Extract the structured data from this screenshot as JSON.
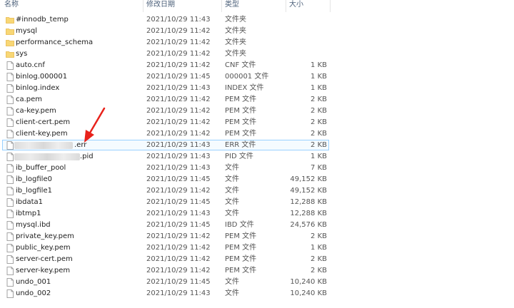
{
  "columns": {
    "name": "名称",
    "date": "修改日期",
    "type": "类型",
    "size": "大小"
  },
  "files": [
    {
      "name": "#innodb_temp",
      "date": "2021/10/29 11:43",
      "type": "文件夹",
      "size": "",
      "kind": "folder"
    },
    {
      "name": "mysql",
      "date": "2021/10/29 11:42",
      "type": "文件夹",
      "size": "",
      "kind": "folder"
    },
    {
      "name": "performance_schema",
      "date": "2021/10/29 11:42",
      "type": "文件夹",
      "size": "",
      "kind": "folder"
    },
    {
      "name": "sys",
      "date": "2021/10/29 11:42",
      "type": "文件夹",
      "size": "",
      "kind": "folder"
    },
    {
      "name": "auto.cnf",
      "date": "2021/10/29 11:42",
      "type": "CNF 文件",
      "size": "1 KB",
      "kind": "file"
    },
    {
      "name": "binlog.000001",
      "date": "2021/10/29 11:45",
      "type": "000001 文件",
      "size": "1 KB",
      "kind": "file"
    },
    {
      "name": "binlog.index",
      "date": "2021/10/29 11:43",
      "type": "INDEX 文件",
      "size": "1 KB",
      "kind": "file"
    },
    {
      "name": "ca.pem",
      "date": "2021/10/29 11:42",
      "type": "PEM 文件",
      "size": "2 KB",
      "kind": "file"
    },
    {
      "name": "ca-key.pem",
      "date": "2021/10/29 11:42",
      "type": "PEM 文件",
      "size": "2 KB",
      "kind": "file"
    },
    {
      "name": "client-cert.pem",
      "date": "2021/10/29 11:42",
      "type": "PEM 文件",
      "size": "2 KB",
      "kind": "file"
    },
    {
      "name": "client-key.pem",
      "date": "2021/10/29 11:42",
      "type": "PEM 文件",
      "size": "2 KB",
      "kind": "file"
    },
    {
      "name": ".err",
      "date": "2021/10/29 11:43",
      "type": "ERR 文件",
      "size": "2 KB",
      "kind": "file"
    },
    {
      "name": ".pid",
      "date": "2021/10/29 11:43",
      "type": "PID 文件",
      "size": "1 KB",
      "kind": "file"
    },
    {
      "name": "ib_buffer_pool",
      "date": "2021/10/29 11:43",
      "type": "文件",
      "size": "7 KB",
      "kind": "file"
    },
    {
      "name": "ib_logfile0",
      "date": "2021/10/29 11:45",
      "type": "文件",
      "size": "49,152 KB",
      "kind": "file"
    },
    {
      "name": "ib_logfile1",
      "date": "2021/10/29 11:42",
      "type": "文件",
      "size": "49,152 KB",
      "kind": "file"
    },
    {
      "name": "ibdata1",
      "date": "2021/10/29 11:45",
      "type": "文件",
      "size": "12,288 KB",
      "kind": "file"
    },
    {
      "name": "ibtmp1",
      "date": "2021/10/29 11:43",
      "type": "文件",
      "size": "12,288 KB",
      "kind": "file"
    },
    {
      "name": "mysql.ibd",
      "date": "2021/10/29 11:45",
      "type": "IBD 文件",
      "size": "24,576 KB",
      "kind": "file"
    },
    {
      "name": "private_key.pem",
      "date": "2021/10/29 11:42",
      "type": "PEM 文件",
      "size": "2 KB",
      "kind": "file"
    },
    {
      "name": "public_key.pem",
      "date": "2021/10/29 11:42",
      "type": "PEM 文件",
      "size": "1 KB",
      "kind": "file"
    },
    {
      "name": "server-cert.pem",
      "date": "2021/10/29 11:42",
      "type": "PEM 文件",
      "size": "2 KB",
      "kind": "file"
    },
    {
      "name": "server-key.pem",
      "date": "2021/10/29 11:42",
      "type": "PEM 文件",
      "size": "2 KB",
      "kind": "file"
    },
    {
      "name": "undo_001",
      "date": "2021/10/29 11:45",
      "type": "文件",
      "size": "10,240 KB",
      "kind": "file"
    },
    {
      "name": "undo_002",
      "date": "2021/10/29 11:43",
      "type": "文件",
      "size": "10,240 KB",
      "kind": "file"
    }
  ],
  "selected_index": 11,
  "redacted_indices": [
    11,
    12
  ],
  "colors": {
    "folder": "#f8d775",
    "folder_dark": "#e8b84a",
    "selection_border": "#99d1ff",
    "arrow": "#e8221b"
  }
}
